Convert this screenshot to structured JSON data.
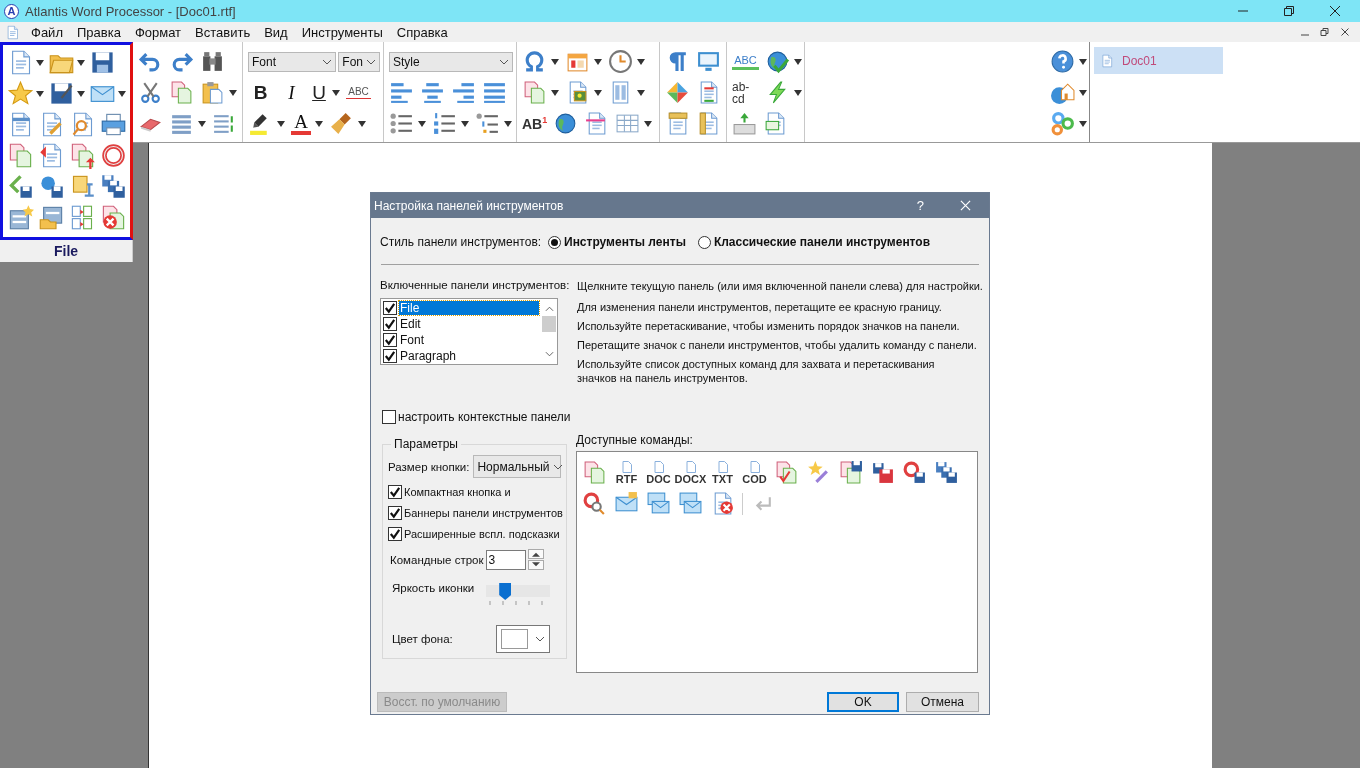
{
  "window": {
    "title": "Atlantis Word Processor - [Doc01.rtf]",
    "logo": "A"
  },
  "menu": [
    "Файл",
    "Правка",
    "Формат",
    "Вставить",
    "Вид",
    "Инструменты",
    "Справка"
  ],
  "toolbar": {
    "file_panel_label": "File",
    "font_box": "Font",
    "size_box": "Fon",
    "style_box": "Style",
    "bold": "B",
    "italic": "I",
    "underline": "U",
    "strikethrough": "ABC",
    "text_color": "A",
    "superscript": "AB$^{1}$",
    "spell_check": "ABC",
    "hyphenation": "ab- cd"
  },
  "documents": [
    {
      "label": "Doc01",
      "selected": true
    }
  ],
  "dialog": {
    "title": "Настройка панелей инструментов",
    "help": "?",
    "style_label": "Стиль панели инструментов:",
    "style_options": [
      {
        "label": "Инструменты ленты",
        "selected": true
      },
      {
        "label": "Классические панели инструментов",
        "selected": false
      }
    ],
    "enabled_label": "Включенные панели инструментов:",
    "panels": [
      {
        "label": "File",
        "checked": true,
        "selected": true
      },
      {
        "label": "Edit",
        "checked": true,
        "selected": false
      },
      {
        "label": "Font",
        "checked": true,
        "selected": false
      },
      {
        "label": "Paragraph",
        "checked": true,
        "selected": false
      }
    ],
    "hints": [
      "Щелкните текущую панель (или имя включенной панели слева) для настройки.",
      "Для изменения панели инструментов, перетащите ее красную границу.",
      "Используйте перетаскивание, чтобы изменить порядок значков на панели.",
      "Перетащите значок с панели инструментов, чтобы удалить команду с панели.",
      "Используйте список доступных команд для захвата и перетаскивания значков на панель инструментов."
    ],
    "contextual": {
      "label": "настроить контекстные панели",
      "checked": false
    },
    "parameters": {
      "title": "Параметры",
      "button_size_label": "Размер кнопки:",
      "button_size": "Нормальный",
      "options": [
        {
          "label": "Компактная кнопка и",
          "checked": true
        },
        {
          "label": "Баннеры панели инструментов",
          "checked": true
        },
        {
          "label": "Расширенные вспл. подсказки",
          "checked": true
        }
      ],
      "rows_label": "Командные строк",
      "rows": "3",
      "brightness_label": "Яркость иконки",
      "brightness": {
        "level": 0.3
      },
      "background_label": "Цвет фона:"
    },
    "commands_label": "Доступные команды:",
    "command_file_labels": [
      "RTF",
      "DOC",
      "DOCX",
      "TXT",
      "COD"
    ],
    "buttons": [
      {
        "label": "Восст. по умолчанию",
        "disabled": true,
        "default": false
      },
      {
        "label": "OK",
        "disabled": false,
        "default": true
      },
      {
        "label": "Отмена",
        "disabled": false,
        "default": false
      }
    ]
  }
}
